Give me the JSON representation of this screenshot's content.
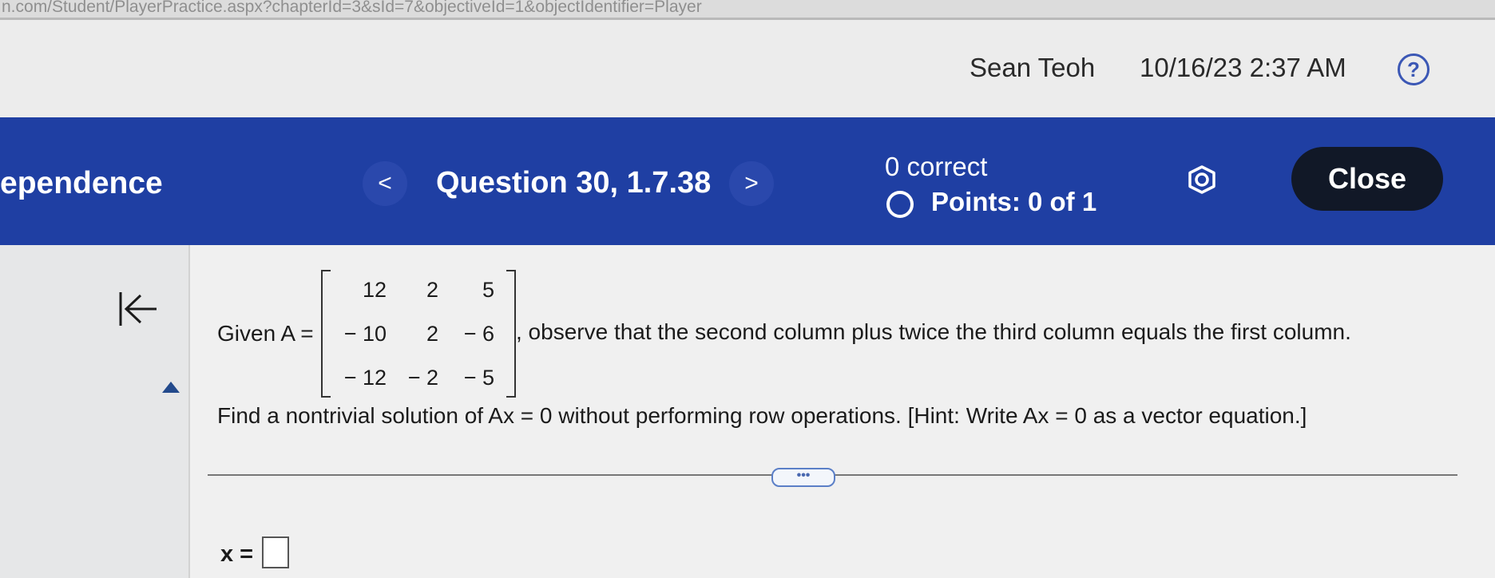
{
  "browser": {
    "url_fragment": "n.com/Student/PlayerPractice.aspx?chapterId=3&sId=7&objectiveId=1&objectIdentifier=Player"
  },
  "userbar": {
    "user_name": "Sean Teoh",
    "timestamp": "10/16/23 2:37 AM",
    "help_label": "?"
  },
  "header": {
    "topic": "ependence",
    "prev_label": "<",
    "question_title": "Question 30, 1.7.38",
    "next_label": ">",
    "correct_text": "0 correct",
    "points_text": "Points: 0 of 1",
    "close_label": "Close",
    "accent_color": "#1f3fa3"
  },
  "problem": {
    "given_label": "Given A =",
    "matrix": [
      [
        "12",
        "2",
        "5"
      ],
      [
        "− 10",
        "2",
        "− 6"
      ],
      [
        "− 12",
        "− 2",
        "− 5"
      ]
    ],
    "observe_text": ", observe that the second column plus twice the third column equals the first column.",
    "find_text": "Find a nontrivial solution of Ax = 0 without performing row operations. [Hint: Write Ax = 0 as a vector equation.]",
    "more_label": "•••"
  },
  "answer": {
    "label": "x ="
  }
}
